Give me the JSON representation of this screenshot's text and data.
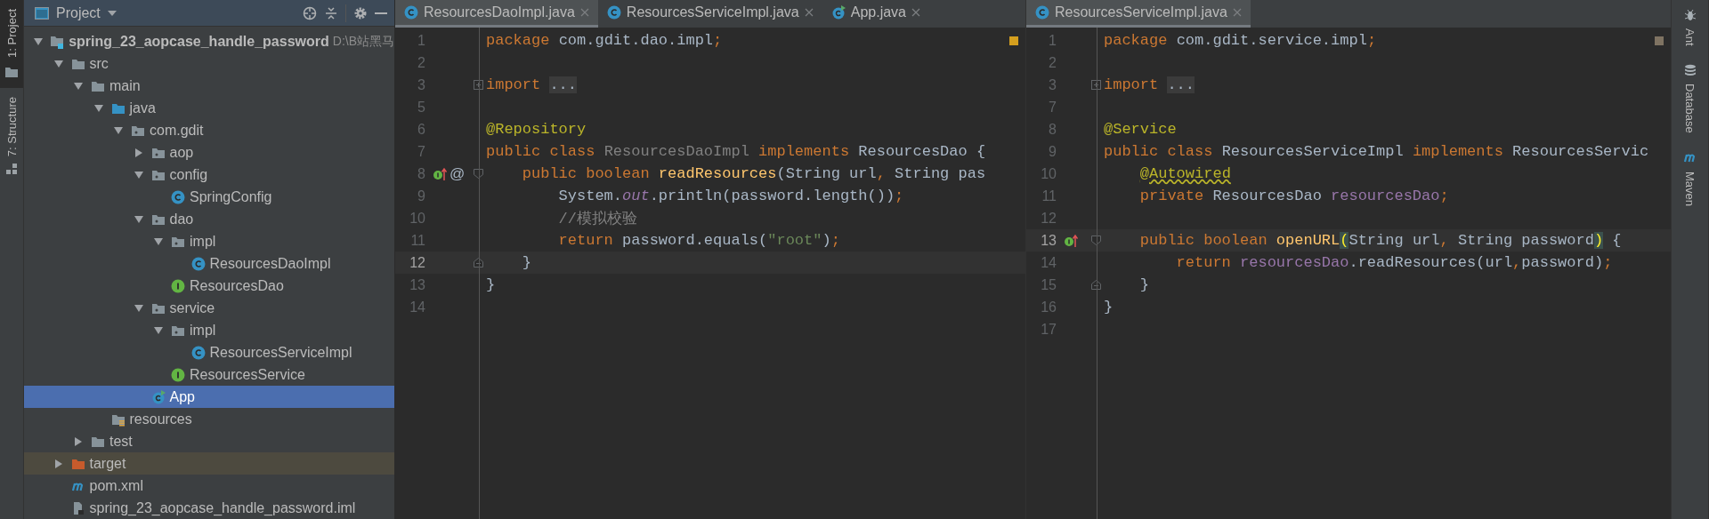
{
  "left_strip": [
    {
      "label": "1: Project",
      "kind": "folder",
      "selected": true
    },
    {
      "label": "7: Structure",
      "kind": "structure",
      "selected": false
    }
  ],
  "project": {
    "title": "Project",
    "tree": [
      {
        "label": "spring_23_aopcase_handle_password",
        "path": "D:\\B站黑马",
        "kind": "module",
        "expanded": true,
        "selected": false,
        "children": [
          {
            "label": "src",
            "kind": "folder",
            "expanded": true,
            "selected": false,
            "children": [
              {
                "label": "main",
                "kind": "folder",
                "expanded": true,
                "selected": false,
                "children": [
                  {
                    "label": "java",
                    "kind": "source-folder",
                    "expanded": true,
                    "selected": false,
                    "children": [
                      {
                        "label": "com.gdit",
                        "kind": "package",
                        "expanded": true,
                        "selected": false,
                        "children": [
                          {
                            "label": "aop",
                            "kind": "package",
                            "expanded": false,
                            "selected": false
                          },
                          {
                            "label": "config",
                            "kind": "package",
                            "expanded": true,
                            "selected": false,
                            "children": [
                              {
                                "label": "SpringConfig",
                                "kind": "class",
                                "selected": false
                              }
                            ]
                          },
                          {
                            "label": "dao",
                            "kind": "package",
                            "expanded": true,
                            "selected": false,
                            "children": [
                              {
                                "label": "impl",
                                "kind": "package",
                                "expanded": true,
                                "selected": false,
                                "children": [
                                  {
                                    "label": "ResourcesDaoImpl",
                                    "kind": "class",
                                    "selected": false
                                  }
                                ]
                              },
                              {
                                "label": "ResourcesDao",
                                "kind": "interface",
                                "selected": false
                              }
                            ]
                          },
                          {
                            "label": "service",
                            "kind": "package",
                            "expanded": true,
                            "selected": false,
                            "children": [
                              {
                                "label": "impl",
                                "kind": "package",
                                "expanded": true,
                                "selected": false,
                                "children": [
                                  {
                                    "label": "ResourcesServiceImpl",
                                    "kind": "class",
                                    "selected": false
                                  }
                                ]
                              },
                              {
                                "label": "ResourcesService",
                                "kind": "interface",
                                "selected": false
                              }
                            ]
                          },
                          {
                            "label": "App",
                            "kind": "main-class",
                            "selected": true
                          }
                        ]
                      }
                    ]
                  },
                  {
                    "label": "resources",
                    "kind": "resources-folder",
                    "selected": false
                  }
                ]
              },
              {
                "label": "test",
                "kind": "folder",
                "expanded": false,
                "selected": false
              }
            ]
          },
          {
            "label": "target",
            "kind": "excluded-folder",
            "expanded": false,
            "selected": false
          },
          {
            "label": "pom.xml",
            "kind": "maven",
            "selected": false
          },
          {
            "label": "spring_23_aopcase_handle_password.iml",
            "kind": "iml",
            "selected": false
          }
        ]
      }
    ]
  },
  "editors": [
    {
      "status": {
        "kind": "warning"
      },
      "tabs": [
        {
          "label": "ResourcesDaoImpl.java",
          "kind": "class",
          "selected": true
        },
        {
          "label": "ResourcesServiceImpl.java",
          "kind": "class",
          "selected": false
        },
        {
          "label": "App.java",
          "kind": "main-class",
          "selected": false
        }
      ],
      "lines": [
        {
          "n": "1",
          "current": false,
          "tokens": [
            {
              "kind": "kw",
              "t": "package "
            },
            {
              "kind": "plain",
              "t": "com.gdit.dao.impl"
            },
            {
              "kind": "kw",
              "t": ";"
            }
          ]
        },
        {
          "n": "2",
          "current": false
        },
        {
          "n": "3",
          "current": false,
          "gutter": [
            {
              "kind": "fold-collapsed"
            }
          ],
          "tokens": [
            {
              "kind": "kw",
              "t": "import "
            },
            {
              "kind": "folded",
              "t": "..."
            }
          ]
        },
        {
          "n": "5",
          "current": false
        },
        {
          "n": "6",
          "current": false,
          "tokens": [
            {
              "kind": "ann",
              "t": "@Repository"
            }
          ]
        },
        {
          "n": "7",
          "current": false,
          "tokens": [
            {
              "kind": "kw",
              "t": "public class "
            },
            {
              "kind": "unused",
              "t": "ResourcesDaoImpl "
            },
            {
              "kind": "kw",
              "t": "implements "
            },
            {
              "kind": "plain",
              "t": "ResourcesDao "
            },
            {
              "kind": "plain",
              "t": "{"
            }
          ]
        },
        {
          "n": "8",
          "current": false,
          "gutter": [
            {
              "kind": "implements"
            },
            {
              "kind": "mark",
              "text": "@"
            },
            {
              "kind": "fold-start"
            }
          ],
          "tokens": [
            {
              "kind": "kw",
              "t": "    public boolean "
            },
            {
              "kind": "decl",
              "t": "readResources"
            },
            {
              "kind": "plain",
              "t": "(String url"
            },
            {
              "kind": "kw",
              "t": ", "
            },
            {
              "kind": "plain",
              "t": "String pas"
            }
          ]
        },
        {
          "n": "9",
          "current": false,
          "tokens": [
            {
              "kind": "plain",
              "t": "        System."
            },
            {
              "kind": "static",
              "t": "out"
            },
            {
              "kind": "plain",
              "t": ".println(password.length())"
            },
            {
              "kind": "kw",
              "t": ";"
            }
          ]
        },
        {
          "n": "10",
          "current": false,
          "tokens": [
            {
              "kind": "comment",
              "t": "        //模拟校验"
            }
          ]
        },
        {
          "n": "11",
          "current": false,
          "tokens": [
            {
              "kind": "kw",
              "t": "        return "
            },
            {
              "kind": "plain",
              "t": "password.equals("
            },
            {
              "kind": "str",
              "t": "\"root\""
            },
            {
              "kind": "plain",
              "t": ")"
            },
            {
              "kind": "kw",
              "t": ";"
            }
          ]
        },
        {
          "n": "12",
          "current": true,
          "gutter": [
            {
              "kind": "fold-end"
            }
          ],
          "tokens": [
            {
              "kind": "plain",
              "t": "    }"
            }
          ]
        },
        {
          "n": "13",
          "current": false,
          "tokens": [
            {
              "kind": "plain",
              "t": "}"
            }
          ]
        },
        {
          "n": "14",
          "current": false
        }
      ]
    },
    {
      "status": {
        "kind": "weak"
      },
      "tabs": [
        {
          "label": "ResourcesServiceImpl.java",
          "kind": "class",
          "selected": true
        }
      ],
      "lines": [
        {
          "n": "1",
          "current": false,
          "tokens": [
            {
              "kind": "kw",
              "t": "package "
            },
            {
              "kind": "plain",
              "t": "com.gdit.service.impl"
            },
            {
              "kind": "kw",
              "t": ";"
            }
          ]
        },
        {
          "n": "2",
          "current": false
        },
        {
          "n": "3",
          "current": false,
          "gutter": [
            {
              "kind": "fold-collapsed"
            }
          ],
          "tokens": [
            {
              "kind": "kw",
              "t": "import "
            },
            {
              "kind": "folded",
              "t": "..."
            }
          ]
        },
        {
          "n": "7",
          "current": false
        },
        {
          "n": "8",
          "current": false,
          "tokens": [
            {
              "kind": "ann",
              "t": "@Service"
            }
          ]
        },
        {
          "n": "9",
          "current": false,
          "tokens": [
            {
              "kind": "kw",
              "t": "public class "
            },
            {
              "kind": "plain",
              "t": "ResourcesServiceImpl "
            },
            {
              "kind": "kw",
              "t": "implements "
            },
            {
              "kind": "plain",
              "t": "ResourcesServic"
            }
          ]
        },
        {
          "n": "10",
          "current": false,
          "tokens": [
            {
              "kind": "ann-warn",
              "t": "    @Autowired"
            }
          ]
        },
        {
          "n": "11",
          "current": false,
          "tokens": [
            {
              "kind": "kw",
              "t": "    private "
            },
            {
              "kind": "plain",
              "t": "ResourcesDao "
            },
            {
              "kind": "field",
              "t": "resourcesDao"
            },
            {
              "kind": "kw",
              "t": ";"
            }
          ]
        },
        {
          "n": "12",
          "current": false
        },
        {
          "n": "13",
          "current": true,
          "gutter": [
            {
              "kind": "implements"
            },
            {
              "kind": "fold-start"
            }
          ],
          "tokens": [
            {
              "kind": "kw",
              "t": "    public boolean "
            },
            {
              "kind": "decl",
              "t": "openURL"
            },
            {
              "kind": "brace",
              "t": "("
            },
            {
              "kind": "plain",
              "t": "String url"
            },
            {
              "kind": "kw",
              "t": ", "
            },
            {
              "kind": "plain",
              "t": "String password"
            },
            {
              "kind": "brace",
              "t": ")"
            },
            {
              "kind": "plain",
              "t": " {"
            }
          ]
        },
        {
          "n": "14",
          "current": false,
          "tokens": [
            {
              "kind": "kw",
              "t": "        return "
            },
            {
              "kind": "field",
              "t": "resourcesDao"
            },
            {
              "kind": "plain",
              "t": ".readResources(url"
            },
            {
              "kind": "kw",
              "t": ","
            },
            {
              "kind": "plain",
              "t": "password)"
            },
            {
              "kind": "kw",
              "t": ";"
            }
          ]
        },
        {
          "n": "15",
          "current": false,
          "gutter": [
            {
              "kind": "fold-end"
            }
          ],
          "tokens": [
            {
              "kind": "plain",
              "t": "    }"
            }
          ]
        },
        {
          "n": "16",
          "current": false,
          "tokens": [
            {
              "kind": "plain",
              "t": "}"
            }
          ]
        },
        {
          "n": "17",
          "current": false
        }
      ]
    }
  ],
  "right_strip": [
    {
      "label": "Ant",
      "kind": "ant"
    },
    {
      "label": "Database",
      "kind": "database"
    },
    {
      "label": "Maven",
      "kind": "maven"
    }
  ]
}
